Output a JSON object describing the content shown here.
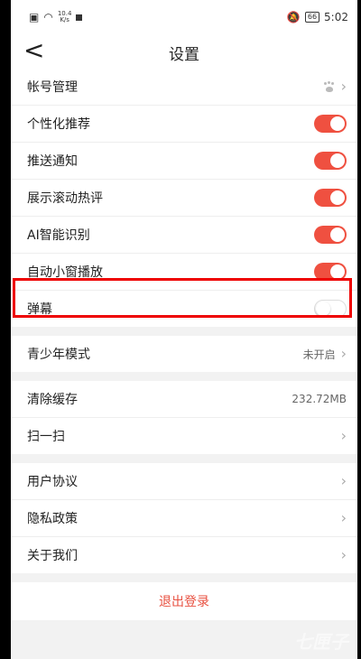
{
  "statusbar": {
    "net_speed": "10.4\nK/s",
    "battery": "66",
    "time": "5:02"
  },
  "header": {
    "back": "<",
    "title": "设置"
  },
  "group1": [
    {
      "label": "帐号管理",
      "type": "link",
      "icon": "paw-icon"
    },
    {
      "label": "个性化推荐",
      "type": "toggle",
      "on": true
    },
    {
      "label": "推送通知",
      "type": "toggle",
      "on": true
    },
    {
      "label": "展示滚动热评",
      "type": "toggle",
      "on": true
    },
    {
      "label": "AI智能识别",
      "type": "toggle",
      "on": true
    },
    {
      "label": "自动小窗播放",
      "type": "toggle",
      "on": true
    },
    {
      "label": "弹幕",
      "type": "toggle",
      "on": false
    }
  ],
  "group2": [
    {
      "label": "青少年模式",
      "value": "未开启"
    }
  ],
  "group3": [
    {
      "label": "清除缓存",
      "value": "232.72MB"
    },
    {
      "label": "扫一扫",
      "value": ""
    }
  ],
  "group4": [
    {
      "label": "用户协议"
    },
    {
      "label": "隐私政策"
    },
    {
      "label": "关于我们"
    }
  ],
  "logout_label": "退出登录",
  "watermark": "七匣子",
  "colors": {
    "accent": "#ef5040",
    "logout": "#e85040",
    "highlight": "#ee0000"
  }
}
